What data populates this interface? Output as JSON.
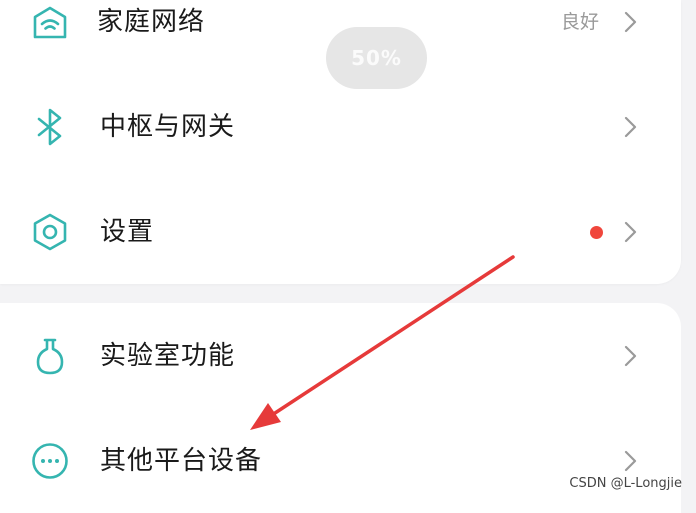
{
  "colors": {
    "accent": "#35b5b0",
    "badge": "#f0463c",
    "chevron": "#9a9a9a",
    "annotation_arrow": "#e63a3a"
  },
  "toast": {
    "text": "50%"
  },
  "groups": [
    {
      "items": [
        {
          "label": "家庭网络",
          "status": "良好",
          "icon": "wifi-home-icon"
        },
        {
          "label": "中枢与网关",
          "icon": "bluetooth-icon"
        },
        {
          "label": "设置",
          "icon": "hexagon-settings-icon",
          "badge": true
        }
      ]
    },
    {
      "items": [
        {
          "label": "实验室功能",
          "icon": "flask-icon"
        },
        {
          "label": "其他平台设备",
          "icon": "more-circle-icon"
        }
      ]
    }
  ],
  "watermark": "CSDN @L-Longjie"
}
